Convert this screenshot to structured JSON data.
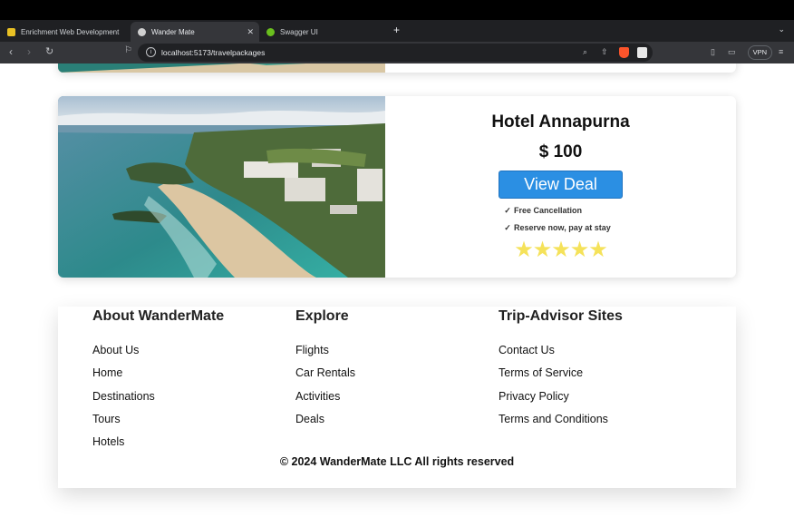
{
  "browser": {
    "tabs": [
      {
        "title": "Enrichment Web Development",
        "active": false,
        "favicon_color": "#e8c024"
      },
      {
        "title": "Wander Mate",
        "active": true,
        "favicon_color": "#d0d0d0"
      },
      {
        "title": "Swagger UI",
        "active": false,
        "favicon_color": "#6abf1e"
      }
    ],
    "new_tab_icon": "plus-icon",
    "url": "localhost:5173/travelpackages",
    "vpn_label": "VPN",
    "brave_badge": "1"
  },
  "listing": {
    "hotel_name": "Hotel Annapurna",
    "price": "$ 100",
    "cta_label": "View Deal",
    "features": [
      "Free Cancellation",
      "Reserve now, pay at stay"
    ],
    "check_glyph": "✓",
    "rating": 5,
    "stars_text": "★★★★★"
  },
  "footer": {
    "columns": [
      {
        "heading": "About WanderMate",
        "links": [
          "About Us",
          "Home",
          "Destinations",
          "Tours",
          "Hotels"
        ]
      },
      {
        "heading": "Explore",
        "links": [
          "Flights",
          "Car Rentals",
          "Activities",
          "Deals"
        ]
      },
      {
        "heading": "Trip-Advisor Sites",
        "links": [
          "Contact Us",
          "Terms of Service",
          "Privacy Policy",
          "Terms and Conditions"
        ]
      }
    ],
    "copyright": "© 2024 WanderMate LLC All rights reserved"
  },
  "colors": {
    "cta": "#2b8fe3",
    "stars": "#f5e25a",
    "browser_chrome": "#35363a"
  }
}
